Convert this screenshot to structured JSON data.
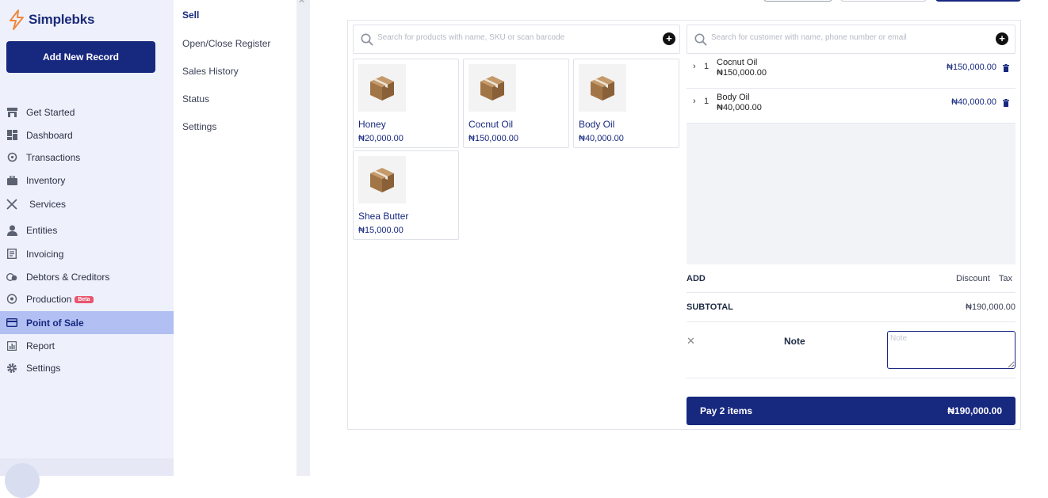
{
  "brand": {
    "name": "Simplebks",
    "color": "#f0883e"
  },
  "sidebar": {
    "add_button": "Add New Record",
    "items": [
      {
        "label": "Get Started",
        "icon": "store-icon"
      },
      {
        "label": "Dashboard",
        "icon": "dashboard-icon"
      },
      {
        "label": "Transactions",
        "icon": "refresh-icon"
      },
      {
        "label": "Inventory",
        "icon": "briefcase-icon"
      },
      {
        "label": "Services",
        "icon": "tools-icon"
      },
      {
        "label": "Entities",
        "icon": "person-icon"
      },
      {
        "label": "Invoicing",
        "icon": "invoice-icon"
      },
      {
        "label": "Debtors & Creditors",
        "icon": "money-icon"
      },
      {
        "label": "Production",
        "icon": "production-icon",
        "badge": "Beta"
      },
      {
        "label": "Point of Sale",
        "icon": "card-icon",
        "active": true
      },
      {
        "label": "Report",
        "icon": "report-icon"
      },
      {
        "label": "Settings",
        "icon": "gear-icon"
      }
    ]
  },
  "submenu": {
    "items": [
      {
        "label": "Sell",
        "active": true
      },
      {
        "label": "Open/Close Register"
      },
      {
        "label": "Sales History"
      },
      {
        "label": "Status"
      },
      {
        "label": "Settings"
      }
    ]
  },
  "pos": {
    "product_search_placeholder": "Search for products with name, SKU or scan barcode",
    "customer_search_placeholder": "Search for customer with name, phone number or email",
    "products": [
      {
        "name": "Honey",
        "price": "₦20,000.00",
        "icon": "box-icon"
      },
      {
        "name": "Cocnut Oil",
        "price": "₦150,000.00",
        "icon": "box-icon"
      },
      {
        "name": "Body Oil",
        "price": "₦40,000.00",
        "icon": "box-icon"
      },
      {
        "name": "Shea Butter",
        "price": "₦15,000.00",
        "icon": "box-icon"
      }
    ],
    "cart": [
      {
        "qty": "1",
        "name": "Cocnut Oil",
        "unit_price": "₦150,000.00",
        "total": "₦150,000.00"
      },
      {
        "qty": "1",
        "name": "Body Oil",
        "unit_price": "₦40,000.00",
        "total": "₦40,000.00"
      }
    ],
    "add_label": "ADD",
    "discount_label": "Discount",
    "tax_label": "Tax",
    "subtotal_label": "SUBTOTAL",
    "subtotal_value": "₦190,000.00",
    "note_label": "Note",
    "note_placeholder": "Note",
    "pay_label": "Pay 2 items",
    "pay_total": "₦190,000.00"
  },
  "colors": {
    "primary": "#17287f",
    "active_nav": "#b2bff3",
    "beta": "#e8556d"
  }
}
